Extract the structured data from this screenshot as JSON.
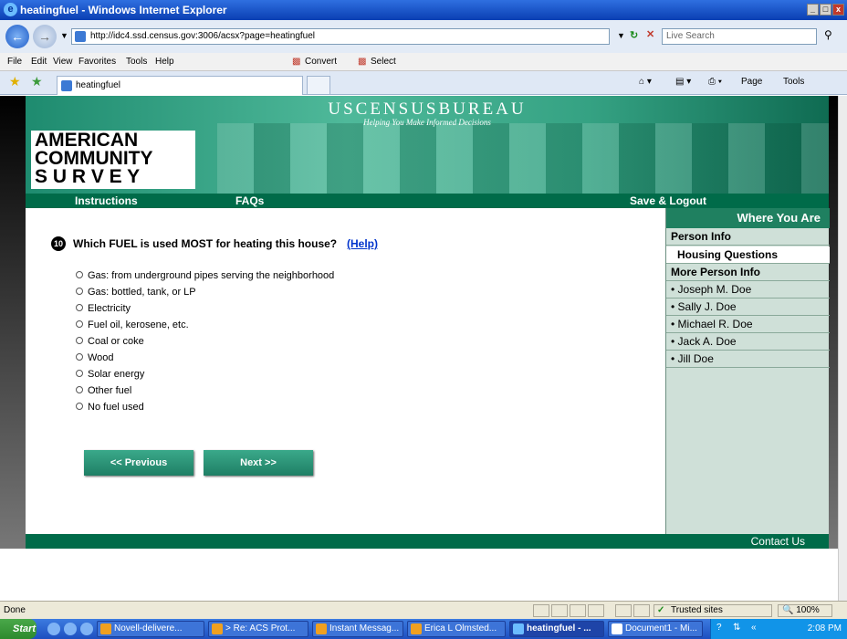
{
  "window": {
    "title": "heatingfuel - Windows Internet Explorer",
    "controls": [
      "_",
      "□",
      "x"
    ]
  },
  "toolbar": {
    "url": "http://idc4.ssd.census.gov:3006/acsx?page=heatingfuel",
    "search_placeholder": "Live Search"
  },
  "menu": {
    "items": [
      "File",
      "Edit",
      "View",
      "Favorites",
      "Tools",
      "Help"
    ],
    "convert": "Convert",
    "select": "Select"
  },
  "tabs": {
    "active_label": "heatingfuel",
    "page_label": "Page",
    "tools_label": "Tools"
  },
  "banner": {
    "bureau": "USCENSUSBUREAU",
    "tagline": "Helping You Make Informed Decisions",
    "logo_lines": [
      "AMERICAN",
      "COMMUNITY",
      "S U R V E Y"
    ]
  },
  "nav": {
    "instructions": "Instructions",
    "faqs": "FAQs",
    "save_logout": "Save & Logout"
  },
  "question": {
    "number": "10",
    "text": "Which FUEL is used MOST for heating this house?",
    "help": "(Help)",
    "options": [
      "Gas: from underground pipes serving the neighborhood",
      "Gas: bottled, tank, or LP",
      "Electricity",
      "Fuel oil, kerosene, etc.",
      "Coal or coke",
      "Wood",
      "Solar energy",
      "Other fuel",
      "No fuel used"
    ],
    "previous": "<< Previous",
    "next": "Next >>"
  },
  "sidebar": {
    "heading": "Where You Are",
    "items": [
      {
        "label": "Person Info",
        "style": "bold"
      },
      {
        "label": "Housing Questions",
        "style": "current"
      },
      {
        "label": "More Person Info",
        "style": "bold"
      },
      {
        "label": "• Joseph M. Doe",
        "style": "normal"
      },
      {
        "label": "• Sally J. Doe",
        "style": "normal"
      },
      {
        "label": "• Michael R. Doe",
        "style": "normal"
      },
      {
        "label": "• Jack A. Doe",
        "style": "normal"
      },
      {
        "label": "• Jill Doe",
        "style": "normal"
      }
    ]
  },
  "footer": {
    "contact": "Contact Us"
  },
  "status": {
    "text": "Done",
    "zone": "Trusted sites",
    "zoom": "100%"
  },
  "taskbar": {
    "start": "Start",
    "tasks": [
      "Novell-delivere...",
      "> Re: ACS Prot...",
      "Instant Messag...",
      "Erica L Olmsted...",
      "heatingfuel - ...",
      "Document1 - Mi..."
    ],
    "clock": "2:08 PM"
  }
}
